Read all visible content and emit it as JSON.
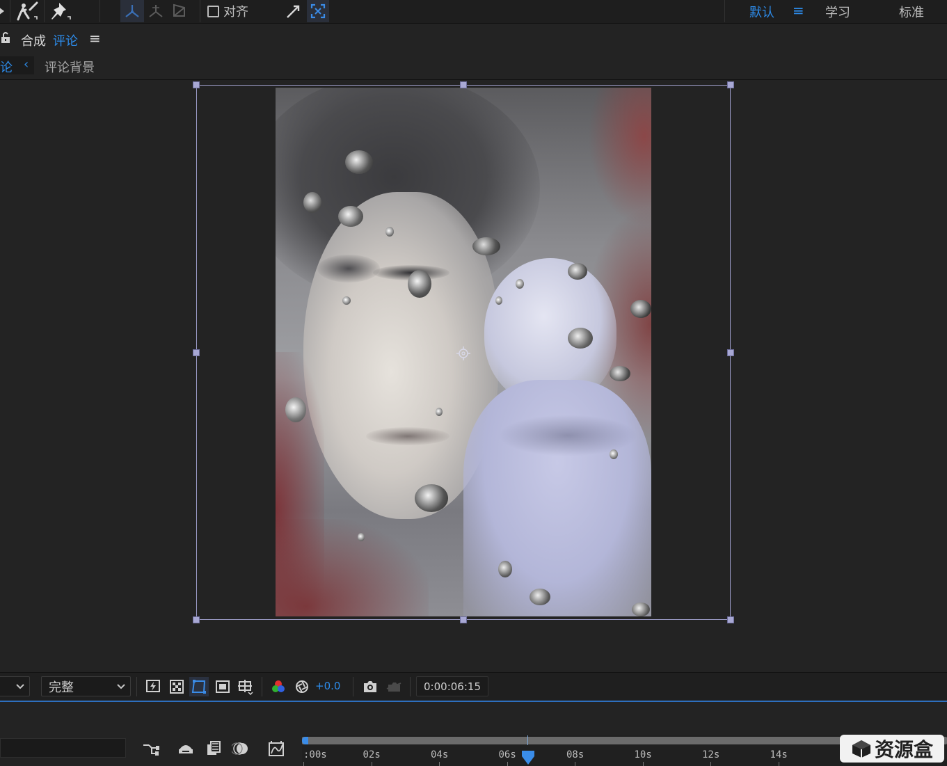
{
  "toolbar": {
    "align_label": "对齐",
    "workspaces": {
      "default": "默认",
      "learn": "学习",
      "standard": "标准"
    }
  },
  "comp_header": {
    "panel_prefix": "合成",
    "comp_name": "评论",
    "menu_glyph": "≡"
  },
  "comp_tabs": {
    "truncated_tab": "论",
    "back_glyph": "‹",
    "inactive_tab": "评论背景"
  },
  "viewer_controls": {
    "resolution": "完整",
    "exposure": "+0.0",
    "timecode": "0:00:06:15"
  },
  "timeline": {
    "ruler_labels": [
      ":00s",
      "02s",
      "04s",
      "06s",
      "08s",
      "10s",
      "12s",
      "14s"
    ],
    "playhead_seconds": 6.6
  },
  "watermark": {
    "text": "资源盒"
  },
  "colors": {
    "accent_blue": "#2d8ceb",
    "bbox": "#9c9cc8",
    "background": "#232323"
  }
}
